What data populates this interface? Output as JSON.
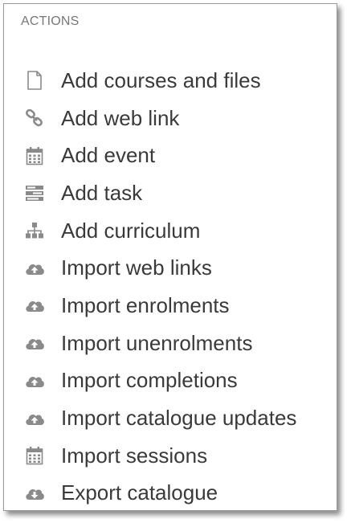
{
  "panel": {
    "header": "ACTIONS",
    "items": [
      {
        "label": "Add courses and files",
        "icon": "file-icon"
      },
      {
        "label": "Add web link",
        "icon": "link-icon"
      },
      {
        "label": "Add event",
        "icon": "calendar-icon"
      },
      {
        "label": "Add task",
        "icon": "tasks-icon"
      },
      {
        "label": "Add curriculum",
        "icon": "sitemap-icon"
      },
      {
        "label": "Import web links",
        "icon": "cloud-upload-icon"
      },
      {
        "label": "Import enrolments",
        "icon": "cloud-upload-icon"
      },
      {
        "label": "Import unenrolments",
        "icon": "cloud-upload-icon"
      },
      {
        "label": "Import completions",
        "icon": "cloud-upload-icon"
      },
      {
        "label": "Import catalogue updates",
        "icon": "cloud-upload-icon"
      },
      {
        "label": "Import sessions",
        "icon": "calendar-icon"
      },
      {
        "label": "Export catalogue",
        "icon": "cloud-download-icon"
      }
    ]
  },
  "colors": {
    "icon": "#8a8a8a",
    "text": "#3a3a3a",
    "header": "#777777",
    "border": "#9a9a9a"
  }
}
